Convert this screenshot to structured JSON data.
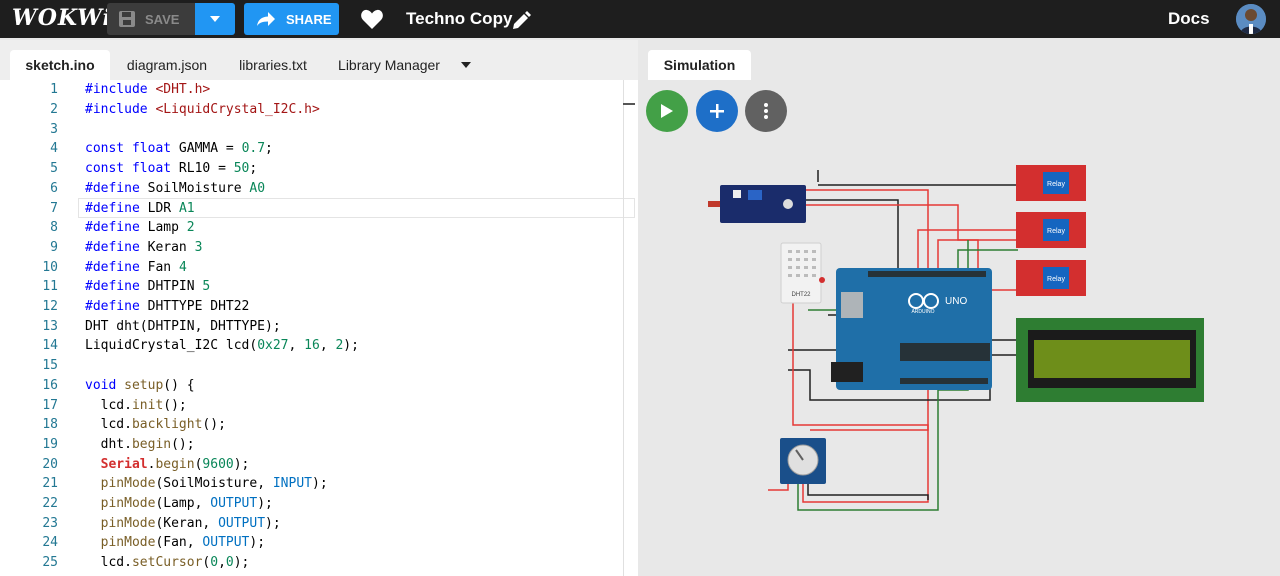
{
  "topbar": {
    "logo": "WOKWi",
    "save_label": "SAVE",
    "share_label": "SHARE",
    "project_title": "Techno Copy",
    "docs_label": "Docs"
  },
  "editor": {
    "tabs": [
      "sketch.ino",
      "diagram.json",
      "libraries.txt",
      "Library Manager"
    ],
    "active_tab": "sketch.ino"
  },
  "simulation": {
    "tab_label": "Simulation",
    "components": {
      "dht_label": "DHT22",
      "relay_label": "Relay",
      "uno_label": "UNO",
      "arduino_label": "ARDUINO"
    }
  },
  "code_lines": [
    "#include <DHT.h>",
    "#include <LiquidCrystal_I2C.h>",
    "",
    "const float GAMMA = 0.7;",
    "const float RL10 = 50;",
    "#define SoilMoisture A0",
    "#define LDR A1",
    "#define Lamp 2",
    "#define Keran 3",
    "#define Fan 4",
    "#define DHTPIN 5",
    "#define DHTTYPE DHT22",
    "DHT dht(DHTPIN, DHTTYPE);",
    "LiquidCrystal_I2C lcd(0x27, 16, 2);",
    "",
    "void setup() {",
    "  lcd.init();",
    "  lcd.backlight();",
    "  dht.begin();",
    "  Serial.begin(9600);",
    "  pinMode(SoilMoisture, INPUT);",
    "  pinMode(Lamp, OUTPUT);",
    "  pinMode(Keran, OUTPUT);",
    "  pinMode(Fan, OUTPUT);",
    "  lcd.setCursor(0,0);"
  ],
  "highlighted_line": 7,
  "colors": {
    "accent": "#2196f3",
    "play": "#43a047",
    "add": "#1e6fc8",
    "more": "#616161",
    "topbar": "#1e1e1e"
  }
}
